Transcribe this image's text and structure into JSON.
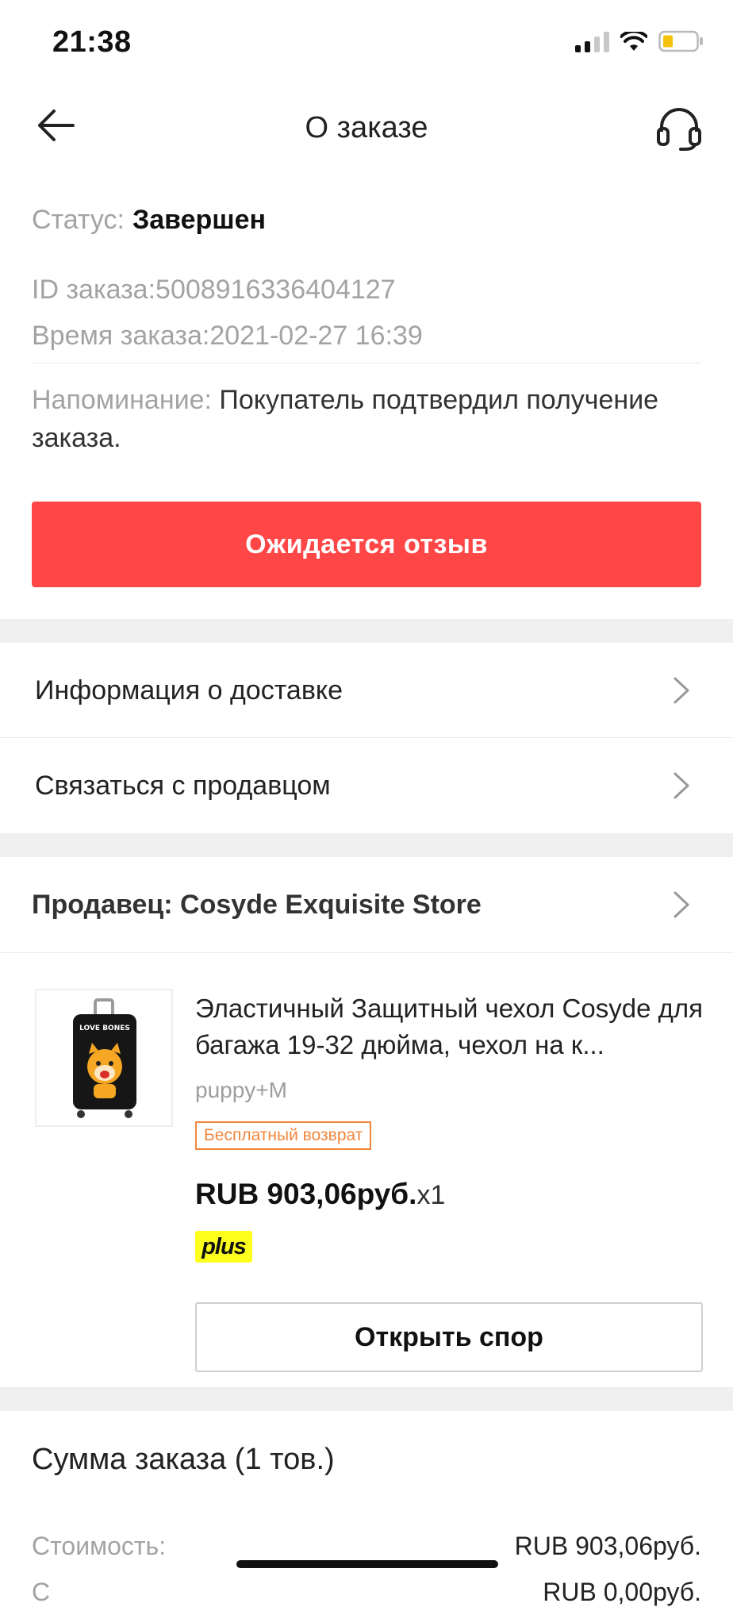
{
  "status_bar": {
    "time": "21:38"
  },
  "header": {
    "title": "О заказе",
    "back_icon": "arrow-left-icon",
    "support_icon": "headset-icon"
  },
  "order": {
    "status_label": "Статус:",
    "status_value": "Завершен",
    "id_text": "ID заказа:5008916336404127",
    "time_text": "Время заказа:2021-02-27 16:39",
    "reminder_label": "Напоминание:",
    "reminder_text": " Покупатель подтвердил получение заказа."
  },
  "review_button": {
    "label": "Ожидается отзыв",
    "color": "#ff4747"
  },
  "menu": {
    "delivery_info": "Информация о доставке",
    "contact_seller": "Связаться с продавцом"
  },
  "seller": {
    "label": "Продавец: Cosyde Exquisite Store"
  },
  "product": {
    "name": "Эластичный Защитный чехол Cosyde для багажа 19-32 дюйма, чехол на к...",
    "variant": "puppy+M",
    "badge": "Бесплатный возврат",
    "price": "RUB 903,06руб.",
    "quantity": "x1",
    "plus_badge": "plus",
    "image_text": "LOVE BONES"
  },
  "dispute_button": {
    "label": "Открыть спор"
  },
  "summary": {
    "title": "Сумма заказа (1 тов.)",
    "cost_label": "Стоимость:",
    "cost_value": "RUB 903,06руб.",
    "next_label": "С",
    "next_value": "RUB 0,00руб."
  }
}
